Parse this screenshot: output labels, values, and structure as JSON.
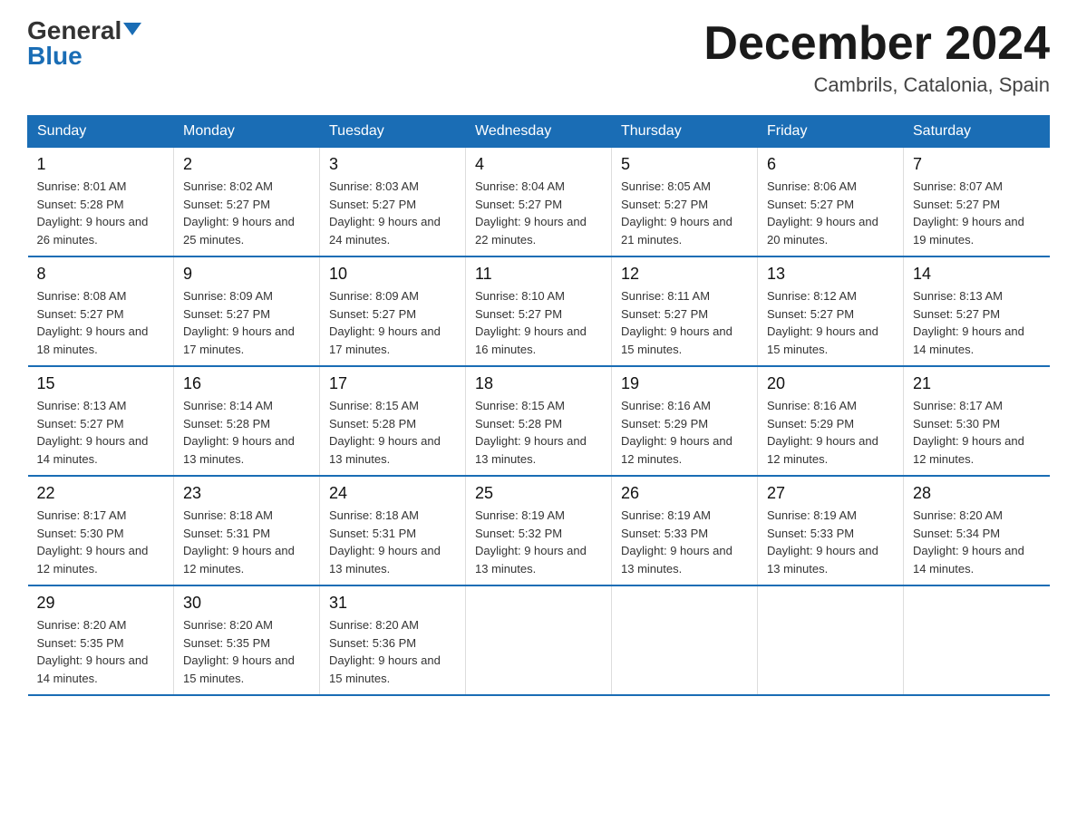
{
  "logo": {
    "general": "General",
    "blue": "Blue",
    "line": ""
  },
  "title": {
    "month_year": "December 2024",
    "location": "Cambrils, Catalonia, Spain"
  },
  "headers": [
    "Sunday",
    "Monday",
    "Tuesday",
    "Wednesday",
    "Thursday",
    "Friday",
    "Saturday"
  ],
  "weeks": [
    [
      {
        "day": "1",
        "sunrise": "8:01 AM",
        "sunset": "5:28 PM",
        "daylight": "9 hours and 26 minutes."
      },
      {
        "day": "2",
        "sunrise": "8:02 AM",
        "sunset": "5:27 PM",
        "daylight": "9 hours and 25 minutes."
      },
      {
        "day": "3",
        "sunrise": "8:03 AM",
        "sunset": "5:27 PM",
        "daylight": "9 hours and 24 minutes."
      },
      {
        "day": "4",
        "sunrise": "8:04 AM",
        "sunset": "5:27 PM",
        "daylight": "9 hours and 22 minutes."
      },
      {
        "day": "5",
        "sunrise": "8:05 AM",
        "sunset": "5:27 PM",
        "daylight": "9 hours and 21 minutes."
      },
      {
        "day": "6",
        "sunrise": "8:06 AM",
        "sunset": "5:27 PM",
        "daylight": "9 hours and 20 minutes."
      },
      {
        "day": "7",
        "sunrise": "8:07 AM",
        "sunset": "5:27 PM",
        "daylight": "9 hours and 19 minutes."
      }
    ],
    [
      {
        "day": "8",
        "sunrise": "8:08 AM",
        "sunset": "5:27 PM",
        "daylight": "9 hours and 18 minutes."
      },
      {
        "day": "9",
        "sunrise": "8:09 AM",
        "sunset": "5:27 PM",
        "daylight": "9 hours and 17 minutes."
      },
      {
        "day": "10",
        "sunrise": "8:09 AM",
        "sunset": "5:27 PM",
        "daylight": "9 hours and 17 minutes."
      },
      {
        "day": "11",
        "sunrise": "8:10 AM",
        "sunset": "5:27 PM",
        "daylight": "9 hours and 16 minutes."
      },
      {
        "day": "12",
        "sunrise": "8:11 AM",
        "sunset": "5:27 PM",
        "daylight": "9 hours and 15 minutes."
      },
      {
        "day": "13",
        "sunrise": "8:12 AM",
        "sunset": "5:27 PM",
        "daylight": "9 hours and 15 minutes."
      },
      {
        "day": "14",
        "sunrise": "8:13 AM",
        "sunset": "5:27 PM",
        "daylight": "9 hours and 14 minutes."
      }
    ],
    [
      {
        "day": "15",
        "sunrise": "8:13 AM",
        "sunset": "5:27 PM",
        "daylight": "9 hours and 14 minutes."
      },
      {
        "day": "16",
        "sunrise": "8:14 AM",
        "sunset": "5:28 PM",
        "daylight": "9 hours and 13 minutes."
      },
      {
        "day": "17",
        "sunrise": "8:15 AM",
        "sunset": "5:28 PM",
        "daylight": "9 hours and 13 minutes."
      },
      {
        "day": "18",
        "sunrise": "8:15 AM",
        "sunset": "5:28 PM",
        "daylight": "9 hours and 13 minutes."
      },
      {
        "day": "19",
        "sunrise": "8:16 AM",
        "sunset": "5:29 PM",
        "daylight": "9 hours and 12 minutes."
      },
      {
        "day": "20",
        "sunrise": "8:16 AM",
        "sunset": "5:29 PM",
        "daylight": "9 hours and 12 minutes."
      },
      {
        "day": "21",
        "sunrise": "8:17 AM",
        "sunset": "5:30 PM",
        "daylight": "9 hours and 12 minutes."
      }
    ],
    [
      {
        "day": "22",
        "sunrise": "8:17 AM",
        "sunset": "5:30 PM",
        "daylight": "9 hours and 12 minutes."
      },
      {
        "day": "23",
        "sunrise": "8:18 AM",
        "sunset": "5:31 PM",
        "daylight": "9 hours and 12 minutes."
      },
      {
        "day": "24",
        "sunrise": "8:18 AM",
        "sunset": "5:31 PM",
        "daylight": "9 hours and 13 minutes."
      },
      {
        "day": "25",
        "sunrise": "8:19 AM",
        "sunset": "5:32 PM",
        "daylight": "9 hours and 13 minutes."
      },
      {
        "day": "26",
        "sunrise": "8:19 AM",
        "sunset": "5:33 PM",
        "daylight": "9 hours and 13 minutes."
      },
      {
        "day": "27",
        "sunrise": "8:19 AM",
        "sunset": "5:33 PM",
        "daylight": "9 hours and 13 minutes."
      },
      {
        "day": "28",
        "sunrise": "8:20 AM",
        "sunset": "5:34 PM",
        "daylight": "9 hours and 14 minutes."
      }
    ],
    [
      {
        "day": "29",
        "sunrise": "8:20 AM",
        "sunset": "5:35 PM",
        "daylight": "9 hours and 14 minutes."
      },
      {
        "day": "30",
        "sunrise": "8:20 AM",
        "sunset": "5:35 PM",
        "daylight": "9 hours and 15 minutes."
      },
      {
        "day": "31",
        "sunrise": "8:20 AM",
        "sunset": "5:36 PM",
        "daylight": "9 hours and 15 minutes."
      },
      null,
      null,
      null,
      null
    ]
  ]
}
